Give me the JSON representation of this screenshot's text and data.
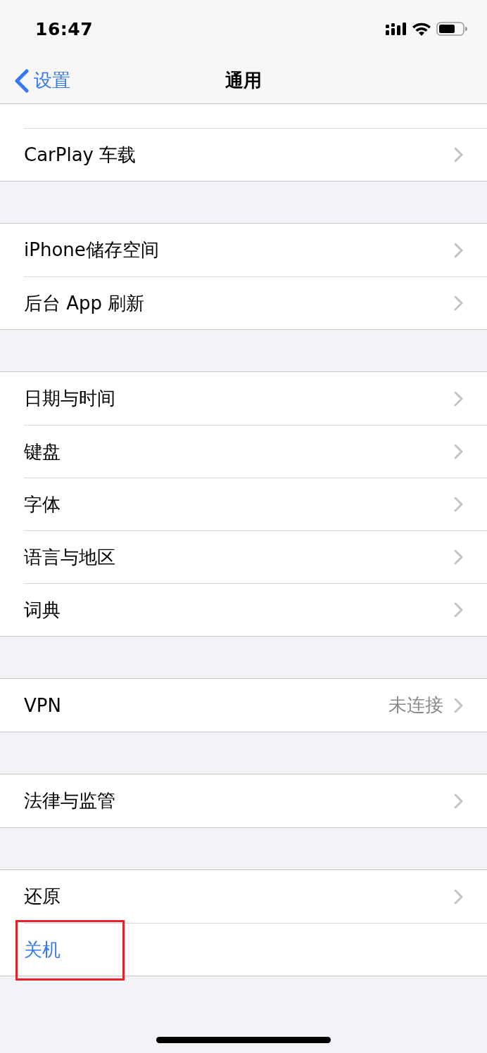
{
  "status_bar": {
    "time": "16:47"
  },
  "nav": {
    "back": "设置",
    "title": "通用"
  },
  "groups": [
    {
      "continued_from_above": true,
      "items": [
        {
          "kind": "link",
          "label": "CarPlay 车载"
        }
      ]
    },
    {
      "continued_from_above": false,
      "items": [
        {
          "kind": "link",
          "label": "iPhone储存空间"
        },
        {
          "kind": "link",
          "label": "后台 App 刷新"
        }
      ]
    },
    {
      "continued_from_above": false,
      "items": [
        {
          "kind": "link",
          "label": "日期与时间"
        },
        {
          "kind": "link",
          "label": "键盘"
        },
        {
          "kind": "link",
          "label": "字体"
        },
        {
          "kind": "link",
          "label": "语言与地区"
        },
        {
          "kind": "link",
          "label": "词典"
        }
      ]
    },
    {
      "continued_from_above": false,
      "items": [
        {
          "kind": "link",
          "label": "VPN",
          "value": "未连接"
        }
      ]
    },
    {
      "continued_from_above": false,
      "items": [
        {
          "kind": "link",
          "label": "法律与监管"
        }
      ]
    },
    {
      "continued_from_above": false,
      "items": [
        {
          "kind": "link",
          "label": "还原",
          "highlighted": false
        },
        {
          "kind": "action",
          "label": "关机",
          "highlighted": true
        }
      ]
    }
  ]
}
